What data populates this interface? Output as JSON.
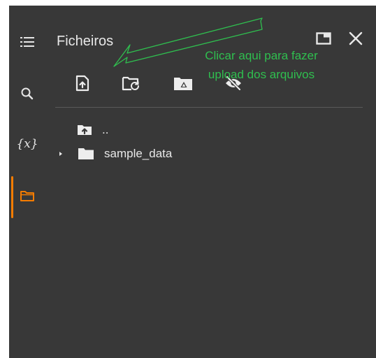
{
  "panel": {
    "title": "Ficheiros"
  },
  "tree": {
    "parent_label": "..",
    "items": [
      {
        "label": "sample_data"
      }
    ]
  },
  "annotation": {
    "line1": "Clicar aqui para fazer",
    "line2": "upload dos arquivos",
    "color": "#2fbf4f"
  },
  "colors": {
    "background": "#383838",
    "accent": "#f57c00",
    "text": "#e8e8e8"
  },
  "icons": {
    "rail": [
      "menu-icon",
      "search-icon",
      "variables-icon",
      "folder-icon"
    ],
    "toolbar": [
      "upload-file-icon",
      "refresh-folder-icon",
      "drive-folder-icon",
      "hide-eye-icon"
    ],
    "window": [
      "expand-window-icon",
      "close-icon"
    ]
  }
}
